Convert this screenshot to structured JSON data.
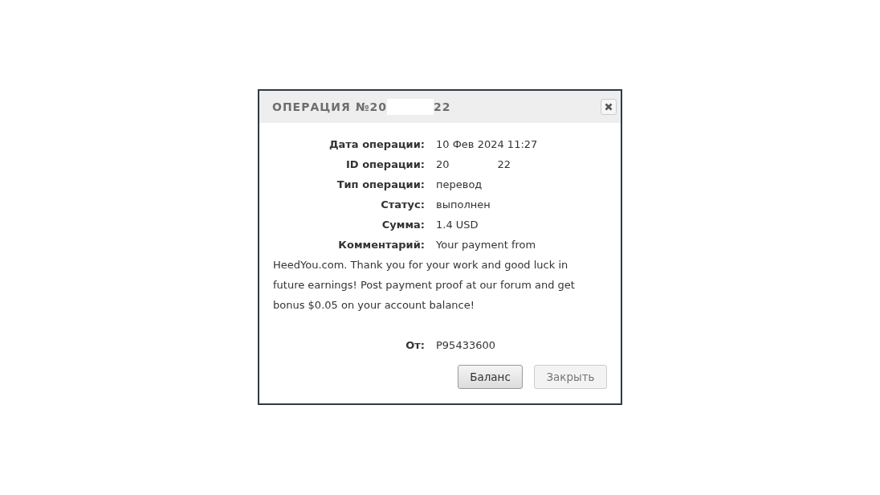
{
  "dialog": {
    "title_start": "ОПЕРАЦИЯ №20",
    "title_end": "22"
  },
  "fields": [
    {
      "label": "Дата операции:",
      "value": "10 Фев 2024 11:27"
    },
    {
      "label": "ID операции:",
      "value": "20",
      "value_end": "22"
    },
    {
      "label": "Тип операции:",
      "value": "перевод"
    },
    {
      "label": "Статус:",
      "value": "выполнен"
    },
    {
      "label": "Сумма:",
      "value": "1.4 USD"
    }
  ],
  "comment": {
    "label": "Комментарий:",
    "value": "Your payment from",
    "value_rest": "HeedYou.com. Thank you for your work and good luck in future earnings! Post payment proof at our forum and get bonus $0.05 on your account balance!"
  },
  "from": {
    "label": "От:",
    "value": "P95433600"
  },
  "buttons": [
    {
      "label": "Баланс",
      "kind": "primary"
    },
    {
      "label": "Закрыть",
      "kind": "secondary"
    }
  ]
}
